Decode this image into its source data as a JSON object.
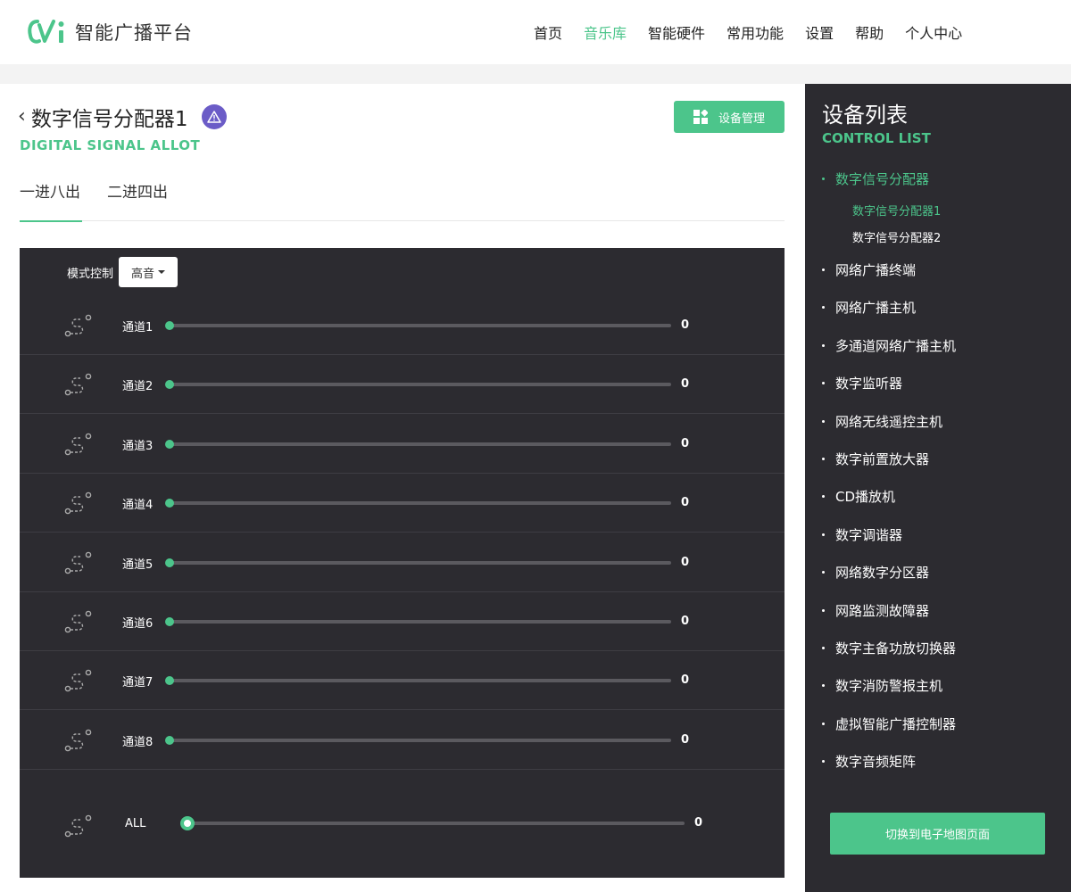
{
  "header": {
    "logo_text": "智能广播平台",
    "nav": [
      {
        "label": "首页",
        "active": false
      },
      {
        "label": "音乐库",
        "active": true
      },
      {
        "label": "智能硬件",
        "active": false
      },
      {
        "label": "常用功能",
        "active": false
      },
      {
        "label": "设置",
        "active": false
      },
      {
        "label": "帮助",
        "active": false
      },
      {
        "label": "个人中心",
        "active": false
      }
    ]
  },
  "main": {
    "title": "数字信号分配器1",
    "subtitle": "DIGITAL SIGNAL ALLOT",
    "manage_button": "设备管理",
    "tabs": [
      {
        "label": "一进八出",
        "active": true
      },
      {
        "label": "二进四出",
        "active": false
      }
    ],
    "mode": {
      "label": "模式控制",
      "selected": "高音"
    },
    "channels": [
      {
        "label": "通道1",
        "value": "0"
      },
      {
        "label": "通道2",
        "value": "0"
      },
      {
        "label": "通道3",
        "value": "0"
      },
      {
        "label": "通道4",
        "value": "0"
      },
      {
        "label": "通道5",
        "value": "0"
      },
      {
        "label": "通道6",
        "value": "0"
      },
      {
        "label": "通道7",
        "value": "0"
      },
      {
        "label": "通道8",
        "value": "0"
      }
    ],
    "all": {
      "label": "ALL",
      "value": "0"
    }
  },
  "sidebar": {
    "title": "设备列表",
    "subtitle": "CONTROL LIST",
    "items": [
      {
        "label": "数字信号分配器",
        "active": true,
        "children": [
          {
            "label": "数字信号分配器1",
            "active": true
          },
          {
            "label": "数字信号分配器2",
            "active": false
          }
        ]
      },
      {
        "label": "网络广播终端"
      },
      {
        "label": "网络广播主机"
      },
      {
        "label": "多通道网络广播主机"
      },
      {
        "label": "数字监听器"
      },
      {
        "label": "网络无线遥控主机"
      },
      {
        "label": "数字前置放大器"
      },
      {
        "label": "CD播放机"
      },
      {
        "label": "数字调谐器"
      },
      {
        "label": "网络数字分区器"
      },
      {
        "label": "网路监测故障器"
      },
      {
        "label": "数字主备功放切换器"
      },
      {
        "label": "数字消防警报主机"
      },
      {
        "label": "虚拟智能广播控制器"
      },
      {
        "label": "数字音频矩阵"
      }
    ],
    "switch_button": "切换到电子地图页面"
  },
  "colors": {
    "accent": "#4cc58b",
    "panel": "#2c2b30",
    "warning_badge": "#6b5cc7"
  },
  "icons": [
    "logo-mark",
    "back-arrow-icon",
    "warning-icon",
    "grid-icon",
    "route-icon",
    "caret-down-icon"
  ]
}
